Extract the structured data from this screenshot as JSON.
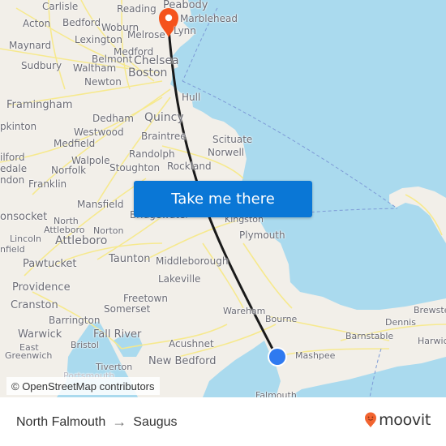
{
  "map": {
    "origin": {
      "name": "North Falmouth",
      "marker": "blue-dot-icon",
      "color": "#2f7af0"
    },
    "destination": {
      "name": "Saugus",
      "marker": "orange-pin-icon",
      "color": "#f5531c"
    },
    "route_line_color": "#1a1a1a",
    "water_color": "#aadaee",
    "land_color": "#f2efe9",
    "places": [
      {
        "id": "carlisle",
        "label": "Carlisle"
      },
      {
        "id": "reading",
        "label": "Reading"
      },
      {
        "id": "peabody",
        "label": "Peabody"
      },
      {
        "id": "marblehead",
        "label": "Marblehead"
      },
      {
        "id": "acton",
        "label": "Acton"
      },
      {
        "id": "bedford",
        "label": "Bedford"
      },
      {
        "id": "woburn",
        "label": "Woburn"
      },
      {
        "id": "lexington",
        "label": "Lexington"
      },
      {
        "id": "melrose",
        "label": "Melrose"
      },
      {
        "id": "lynn",
        "label": "Lynn"
      },
      {
        "id": "maynard",
        "label": "Maynard"
      },
      {
        "id": "medford",
        "label": "Medford"
      },
      {
        "id": "belmont",
        "label": "Belmont"
      },
      {
        "id": "chelsea",
        "label": "Chelsea"
      },
      {
        "id": "sudbury",
        "label": "Sudbury"
      },
      {
        "id": "waltham",
        "label": "Waltham"
      },
      {
        "id": "boston",
        "label": "Boston"
      },
      {
        "id": "newton",
        "label": "Newton"
      },
      {
        "id": "hull",
        "label": "Hull"
      },
      {
        "id": "framingham",
        "label": "Framingham"
      },
      {
        "id": "hopkinton",
        "label": "pkinton"
      },
      {
        "id": "dedham",
        "label": "Dedham"
      },
      {
        "id": "quincy",
        "label": "Quincy"
      },
      {
        "id": "westwood",
        "label": "Westwood"
      },
      {
        "id": "braintree",
        "label": "Braintree"
      },
      {
        "id": "medfield",
        "label": "Medfield"
      },
      {
        "id": "scituate",
        "label": "Scituate"
      },
      {
        "id": "randolph",
        "label": "Randolph"
      },
      {
        "id": "norwell",
        "label": "Norwell"
      },
      {
        "id": "milford",
        "label": "ilford"
      },
      {
        "id": "walpole",
        "label": "Walpole"
      },
      {
        "id": "bellingham",
        "label": "edale"
      },
      {
        "id": "norfolk",
        "label": "Norfolk"
      },
      {
        "id": "stoughton",
        "label": "Stoughton"
      },
      {
        "id": "rockland",
        "label": "Rockland"
      },
      {
        "id": "blackstone",
        "label": "ndon"
      },
      {
        "id": "franklin",
        "label": "Franklin"
      },
      {
        "id": "mansfield",
        "label": "Mansfield"
      },
      {
        "id": "bridgewater",
        "label": "Bridgewater"
      },
      {
        "id": "kingston",
        "label": "Kingston"
      },
      {
        "id": "woonsocket",
        "label": "onsocket"
      },
      {
        "id": "north-attleboro-1",
        "label": "North"
      },
      {
        "id": "north-attleboro-2",
        "label": "Attleboro"
      },
      {
        "id": "norton",
        "label": "Norton"
      },
      {
        "id": "plymouth",
        "label": "Plymouth"
      },
      {
        "id": "lincoln",
        "label": "Lincoln"
      },
      {
        "id": "attleboro",
        "label": "Attleboro"
      },
      {
        "id": "cumberland",
        "label": "nfield"
      },
      {
        "id": "taunton",
        "label": "Taunton"
      },
      {
        "id": "middleborough",
        "label": "Middleborough"
      },
      {
        "id": "pawtucket",
        "label": "Pawtucket"
      },
      {
        "id": "lakeville",
        "label": "Lakeville"
      },
      {
        "id": "providence",
        "label": "Providence"
      },
      {
        "id": "freetown",
        "label": "Freetown"
      },
      {
        "id": "cranston",
        "label": "Cranston"
      },
      {
        "id": "somerset",
        "label": "Somerset"
      },
      {
        "id": "wareham",
        "label": "Wareham"
      },
      {
        "id": "brewster",
        "label": "Brewster"
      },
      {
        "id": "barrington",
        "label": "Barrington"
      },
      {
        "id": "bourne",
        "label": "Bourne"
      },
      {
        "id": "dennis",
        "label": "Dennis"
      },
      {
        "id": "warwick",
        "label": "Warwick"
      },
      {
        "id": "fall-river",
        "label": "Fall River"
      },
      {
        "id": "barnstable",
        "label": "Barnstable"
      },
      {
        "id": "harwich",
        "label": "Harwic"
      },
      {
        "id": "east-greenwich-1",
        "label": "East"
      },
      {
        "id": "east-greenwich-2",
        "label": "Greenwich"
      },
      {
        "id": "bristol",
        "label": "Bristol"
      },
      {
        "id": "acushnet",
        "label": "Acushnet"
      },
      {
        "id": "mashpee",
        "label": "Mashpee"
      },
      {
        "id": "new-bedford",
        "label": "New Bedford"
      },
      {
        "id": "tiverton",
        "label": "Tiverton"
      },
      {
        "id": "portsmouth",
        "label": "Portsmouth"
      },
      {
        "id": "falmouth",
        "label": "Falmouth"
      }
    ],
    "cta_label": "Take me there",
    "attribution": "© OpenStreetMap contributors"
  },
  "footer": {
    "origin_label": "North Falmouth",
    "arrow": "→",
    "destination_label": "Saugus",
    "brand": "moovit",
    "brand_color": "#f26430"
  }
}
